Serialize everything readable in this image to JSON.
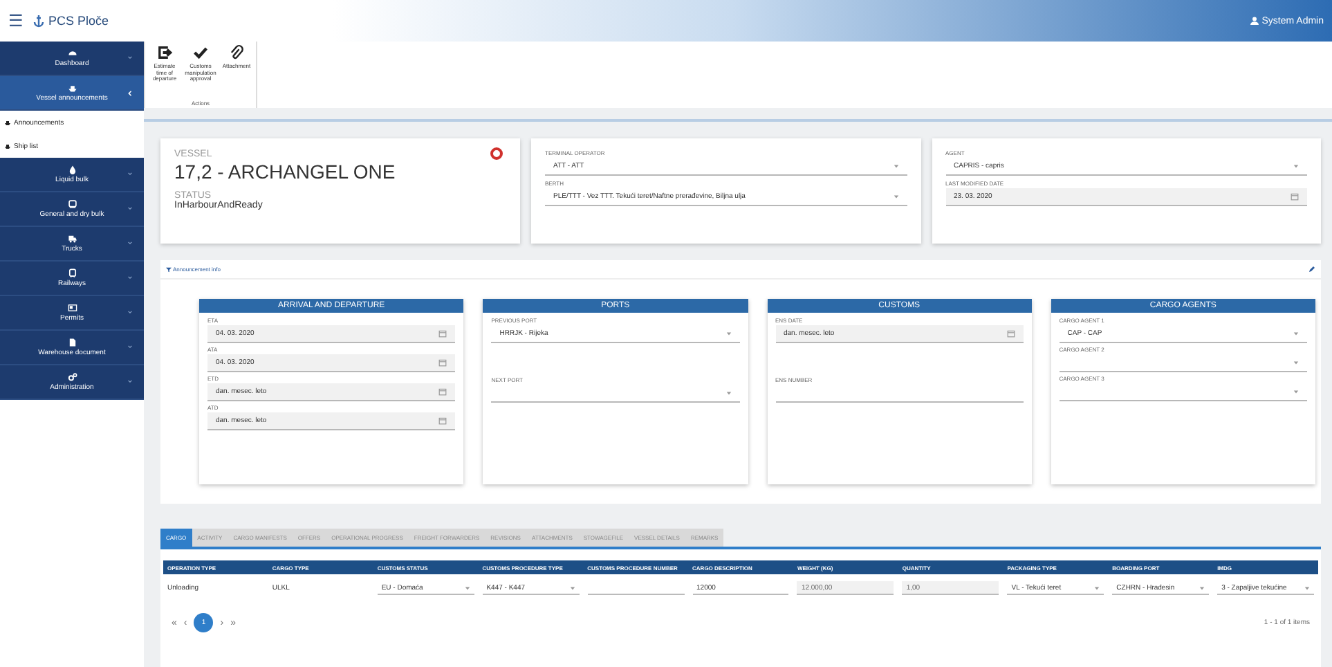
{
  "header": {
    "menu": "☰",
    "logo": "PCS Ploče",
    "user": "System Admin"
  },
  "sidebar": {
    "items": [
      {
        "label": "Dashboard",
        "selected": false,
        "expanded": false
      },
      {
        "label": "Vessel announcements",
        "selected": true,
        "expanded": true,
        "children": [
          {
            "label": "Announcements",
            "selected": false
          },
          {
            "label": "Ship list",
            "selected": false
          }
        ]
      },
      {
        "label": "Liquid bulk",
        "selected": false,
        "expanded": false
      },
      {
        "label": "General and dry bulk",
        "selected": false,
        "expanded": false
      },
      {
        "label": "Trucks",
        "selected": false,
        "expanded": false
      },
      {
        "label": "Railways",
        "selected": false,
        "expanded": false
      },
      {
        "label": "Permits",
        "selected": false,
        "expanded": false
      },
      {
        "label": "Warehouse document",
        "selected": false,
        "expanded": false
      },
      {
        "label": "Administration",
        "selected": false,
        "expanded": false
      }
    ]
  },
  "toolbar": {
    "actions": [
      {
        "label": "Estimate time of departure"
      },
      {
        "label": "Customs manipulation approval"
      },
      {
        "label": "Attachment"
      }
    ],
    "group_label": "Actions"
  },
  "vessel_card": {
    "vessel_label": "VESSEL",
    "vessel": "17,2 - ARCHANGEL ONE",
    "status_label": "STATUS",
    "status": "InHarbourAndReady"
  },
  "field_cards": [
    {
      "fields": [
        {
          "label": "TERMINAL OPERATOR",
          "value": "ATT - ATT",
          "kind": "select"
        },
        {
          "label": "BERTH",
          "value": "PLE/TTT - Vez TTT. Tekući teret/Naftne prerađevine, Biljna ulja",
          "kind": "select"
        }
      ]
    },
    {
      "fields": [
        {
          "label": "AGENT",
          "value": "CAPRIS - capris",
          "kind": "select"
        },
        {
          "label": "LAST MODIFIED DATE",
          "value": "23. 03. 2020",
          "kind": "date"
        }
      ]
    }
  ],
  "section": {
    "title": "Announcement info"
  },
  "panels": [
    {
      "title": "ARRIVAL AND DEPARTURE",
      "fields": [
        {
          "label": "ETA",
          "value": "04. 03. 2020",
          "kind": "date"
        },
        {
          "label": "ATA",
          "value": "04. 03. 2020",
          "kind": "date"
        },
        {
          "label": "ETD",
          "value": "dan. mesec. leto",
          "kind": "date"
        },
        {
          "label": "ATD",
          "value": "dan. mesec. leto",
          "kind": "date"
        }
      ]
    },
    {
      "title": "PORTS",
      "fields": [
        {
          "label": "PREVIOUS PORT",
          "value": "HRRJK - Rijeka",
          "kind": "select"
        },
        {
          "label": "NEXT PORT",
          "kind": "select"
        }
      ]
    },
    {
      "title": "CUSTOMS",
      "fields": [
        {
          "label": "ENS DATE",
          "value": "dan. mesec. leto",
          "kind": "date"
        },
        {
          "label": "ENS NUMBER",
          "kind": "text"
        }
      ]
    },
    {
      "title": "CARGO AGENTS",
      "fields": [
        {
          "label": "CARGO AGENT 1",
          "value": "CAP - CAP",
          "kind": "select"
        },
        {
          "label": "CARGO AGENT 2",
          "kind": "select"
        },
        {
          "label": "CARGO AGENT 3",
          "kind": "select"
        }
      ]
    }
  ],
  "tabs": [
    {
      "label": "CARGO",
      "selected": true
    },
    {
      "label": "ACTIVITY",
      "selected": false
    },
    {
      "label": "CARGO MANIFESTS",
      "selected": false
    },
    {
      "label": "OFFERS",
      "selected": false
    },
    {
      "label": "OPERATIONAL PROGRESS",
      "selected": false
    },
    {
      "label": "FREIGHT FORWARDERS",
      "selected": false
    },
    {
      "label": "REVISIONS",
      "selected": false
    },
    {
      "label": "ATTACHMENTS",
      "selected": false
    },
    {
      "label": "STOWAGEFILE",
      "selected": false
    },
    {
      "label": "VESSEL DETAILS",
      "selected": false
    },
    {
      "label": "REMARKS",
      "selected": false
    }
  ],
  "table": {
    "columns": [
      "OPERATION TYPE",
      "CARGO TYPE",
      "CUSTOMS STATUS",
      "CUSTOMS PROCEDURE TYPE",
      "CUSTOMS PROCEDURE NUMBER",
      "CARGO DESCRIPTION",
      "WEIGHT (KG)",
      "QUANTITY",
      "PACKAGING TYPE",
      "BOARDING PORT",
      "IMDG"
    ],
    "rows": [
      [
        {
          "value": "Unloading",
          "kind": "text"
        },
        {
          "value": "ULKL",
          "kind": "text"
        },
        {
          "value": "EU - Domaća",
          "kind": "select"
        },
        {
          "value": "K447 - K447",
          "kind": "select"
        },
        {
          "kind": "input"
        },
        {
          "value": "12000",
          "kind": "input"
        },
        {
          "value": "12.000,00",
          "kind": "readonly"
        },
        {
          "value": "1,00",
          "kind": "readonly"
        },
        {
          "value": "VL - Tekući teret",
          "kind": "select"
        },
        {
          "value": "CZHRN - Hradesin",
          "kind": "select"
        },
        {
          "value": "3 - Zapaljive tekućine",
          "kind": "select"
        }
      ]
    ]
  },
  "pagination": {
    "prev": [
      "«",
      "‹"
    ],
    "pages": [
      {
        "label": "1",
        "selected": true
      }
    ],
    "next": [
      "›",
      "»"
    ],
    "summary": "1 - 1 of 1 items"
  }
}
